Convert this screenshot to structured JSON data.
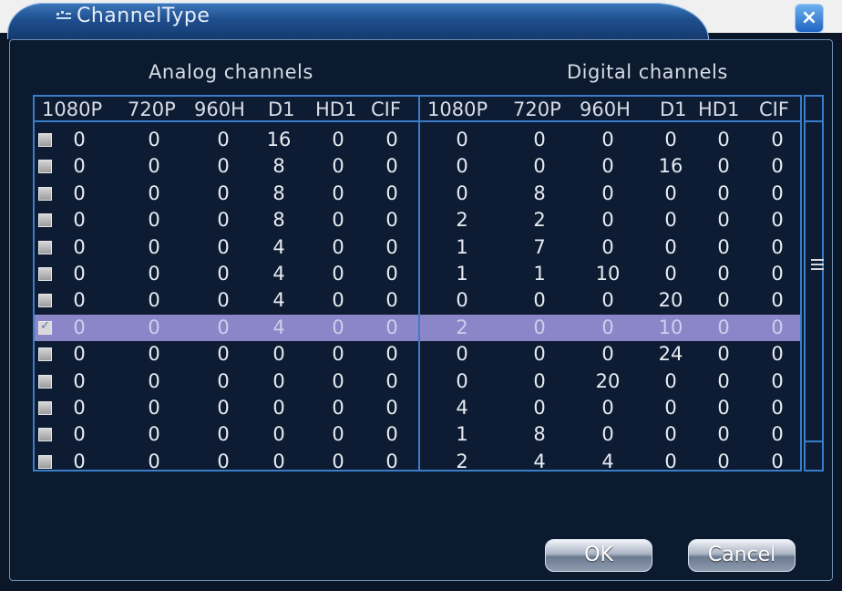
{
  "window": {
    "title": "ChannelType",
    "close_label": "×"
  },
  "groups": {
    "analog": "Analog channels",
    "digital": "Digital channels"
  },
  "headers": {
    "analog": [
      "1080P",
      "720P",
      "960H",
      "D1",
      "HD1",
      "CIF"
    ],
    "digital": [
      "1080P",
      "720P",
      "960H",
      "D1",
      "HD1",
      "CIF"
    ]
  },
  "rows": [
    {
      "checked": false,
      "analog": [
        "0",
        "0",
        "0",
        "16",
        "0",
        "0"
      ],
      "digital": [
        "0",
        "0",
        "0",
        "0",
        "0",
        "0"
      ]
    },
    {
      "checked": false,
      "analog": [
        "0",
        "0",
        "0",
        "8",
        "0",
        "0"
      ],
      "digital": [
        "0",
        "0",
        "0",
        "16",
        "0",
        "0"
      ]
    },
    {
      "checked": false,
      "analog": [
        "0",
        "0",
        "0",
        "8",
        "0",
        "0"
      ],
      "digital": [
        "0",
        "8",
        "0",
        "0",
        "0",
        "0"
      ]
    },
    {
      "checked": false,
      "analog": [
        "0",
        "0",
        "0",
        "8",
        "0",
        "0"
      ],
      "digital": [
        "2",
        "2",
        "0",
        "0",
        "0",
        "0"
      ]
    },
    {
      "checked": false,
      "analog": [
        "0",
        "0",
        "0",
        "4",
        "0",
        "0"
      ],
      "digital": [
        "1",
        "7",
        "0",
        "0",
        "0",
        "0"
      ]
    },
    {
      "checked": false,
      "analog": [
        "0",
        "0",
        "0",
        "4",
        "0",
        "0"
      ],
      "digital": [
        "1",
        "1",
        "10",
        "0",
        "0",
        "0"
      ]
    },
    {
      "checked": false,
      "analog": [
        "0",
        "0",
        "0",
        "4",
        "0",
        "0"
      ],
      "digital": [
        "0",
        "0",
        "0",
        "20",
        "0",
        "0"
      ]
    },
    {
      "checked": true,
      "selected": true,
      "analog": [
        "0",
        "0",
        "0",
        "4",
        "0",
        "0"
      ],
      "digital": [
        "2",
        "0",
        "0",
        "10",
        "0",
        "0"
      ]
    },
    {
      "checked": false,
      "analog": [
        "0",
        "0",
        "0",
        "0",
        "0",
        "0"
      ],
      "digital": [
        "0",
        "0",
        "0",
        "24",
        "0",
        "0"
      ]
    },
    {
      "checked": false,
      "analog": [
        "0",
        "0",
        "0",
        "0",
        "0",
        "0"
      ],
      "digital": [
        "0",
        "0",
        "20",
        "0",
        "0",
        "0"
      ]
    },
    {
      "checked": false,
      "analog": [
        "0",
        "0",
        "0",
        "0",
        "0",
        "0"
      ],
      "digital": [
        "4",
        "0",
        "0",
        "0",
        "0",
        "0"
      ]
    },
    {
      "checked": false,
      "analog": [
        "0",
        "0",
        "0",
        "0",
        "0",
        "0"
      ],
      "digital": [
        "1",
        "8",
        "0",
        "0",
        "0",
        "0"
      ]
    },
    {
      "checked": false,
      "partial": true,
      "analog": [
        "0",
        "0",
        "0",
        "0",
        "0",
        "0"
      ],
      "digital": [
        "2",
        "4",
        "4",
        "0",
        "0",
        "0"
      ]
    }
  ],
  "buttons": {
    "ok": "OK",
    "cancel": "Cancel"
  },
  "colors": {
    "selected_row": "#8a86c8",
    "border": "#3a7dc8",
    "title_bar": "#1f4f8e"
  }
}
